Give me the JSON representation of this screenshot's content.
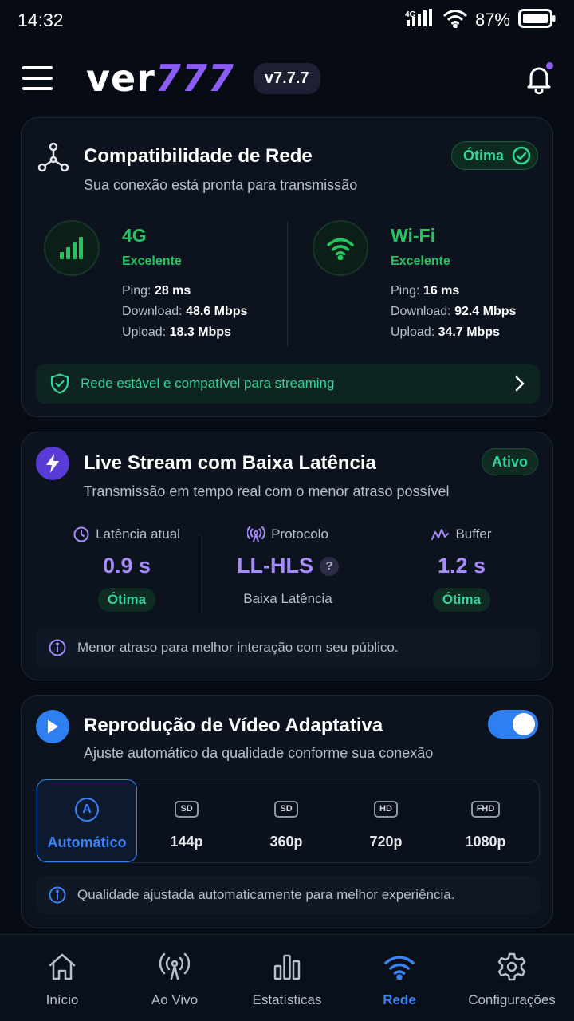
{
  "status_bar": {
    "time": "14:32",
    "network_label": "4G",
    "battery": "87%"
  },
  "header": {
    "logo_prefix": "ver",
    "logo_suffix": "777",
    "version": "v7.7.7",
    "icons": [
      "menu-icon",
      "bell-icon"
    ]
  },
  "network_card": {
    "title": "Compatibilidade de Rede",
    "subtitle": "Sua conexão está pronta para transmissão",
    "status": "Ótima",
    "connections": [
      {
        "name": "4G",
        "quality": "Excelente",
        "ping_label": "Ping:",
        "ping": "28 ms",
        "download_label": "Download:",
        "download": "48.6 Mbps",
        "upload_label": "Upload:",
        "upload": "18.3 Mbps"
      },
      {
        "name": "Wi-Fi",
        "quality": "Excelente",
        "ping_label": "Ping:",
        "ping": "16 ms",
        "download_label": "Download:",
        "download": "92.4 Mbps",
        "upload_label": "Upload:",
        "upload": "34.7 Mbps"
      }
    ],
    "footer": "Rede estável e compatível para streaming"
  },
  "live_card": {
    "title": "Live Stream com Baixa Latência",
    "subtitle": "Transmissão em tempo real com o menor atraso possível",
    "status": "Ativo",
    "metrics": [
      {
        "label": "Latência atual",
        "value": "0.9 s",
        "badge": "Ótima"
      },
      {
        "label": "Protocolo",
        "value": "LL-HLS",
        "help": "?",
        "sub": "Baixa Latência"
      },
      {
        "label": "Buffer",
        "value": "1.2 s",
        "badge": "Ótima"
      }
    ],
    "info": "Menor atraso para melhor interação com seu público."
  },
  "video_card": {
    "title": "Reprodução de Vídeo Adaptativa",
    "subtitle": "Ajuste automático da qualidade conforme sua conexão",
    "toggle_on": true,
    "options": [
      {
        "icon": "A",
        "label": "Automático",
        "selected": true
      },
      {
        "icon": "SD",
        "label": "144p"
      },
      {
        "icon": "SD",
        "label": "360p"
      },
      {
        "icon": "HD",
        "label": "720p"
      },
      {
        "icon": "FHD",
        "label": "1080p"
      }
    ],
    "info": "Qualidade ajustada automaticamente para melhor experiência."
  },
  "bottom_nav": {
    "items": [
      {
        "label": "Início",
        "icon": "home-icon"
      },
      {
        "label": "Ao Vivo",
        "icon": "broadcast-icon"
      },
      {
        "label": "Estatísticas",
        "icon": "bar-chart-icon"
      },
      {
        "label": "Rede",
        "icon": "wifi-icon",
        "active": true
      },
      {
        "label": "Configurações",
        "icon": "gear-icon"
      }
    ]
  },
  "colors": {
    "background": "#060b14",
    "card": "#0c131f",
    "green": "#22c55e",
    "purple": "#8b5cf6",
    "blue": "#2f7ff0"
  }
}
